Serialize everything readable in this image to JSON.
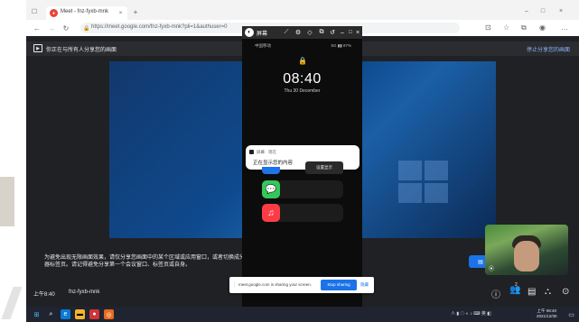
{
  "browser": {
    "tab_title": "Meet - fnz-fyxb-mnk",
    "url": "https://meet.google.com/fnz-fyxb-mnk?pli=1&authuser=0"
  },
  "meet": {
    "banner_text": "你正在与所有人分享您的画面",
    "banner_stop": "停止分享您的画面",
    "note": "为避免出现无限画面效果，请仅分享您画面中的某个区域或应用窗口，或者切换成分享浏览器标签页。请记得避免分享第一个会议窗口、标签页或自身。",
    "meeting_time": "上午8:40",
    "meeting_code": "fnz-fyxb-mnk",
    "participant_count": "2"
  },
  "phone": {
    "window_title": "屏幕",
    "carrier": "中国移动",
    "status_right": "5G ▮▮ 87%",
    "clock": "08:40",
    "date": "Thu 30 December",
    "notification_app": "屏幕 · 现在",
    "notification_body": "正在显示您的内容",
    "display_button": "设置显示"
  },
  "share_bar": {
    "text": "meet.google.com is sharing your screen.",
    "stop_label": "Stop sharing",
    "hide_label": "隐藏"
  },
  "taskbar": {
    "tray_time": "上午 08:40",
    "tray_date": "2021/12/30"
  },
  "colors": {
    "meet_bg": "#202124",
    "accent_blue": "#1a73e8",
    "link_blue": "#8ab4f8"
  }
}
